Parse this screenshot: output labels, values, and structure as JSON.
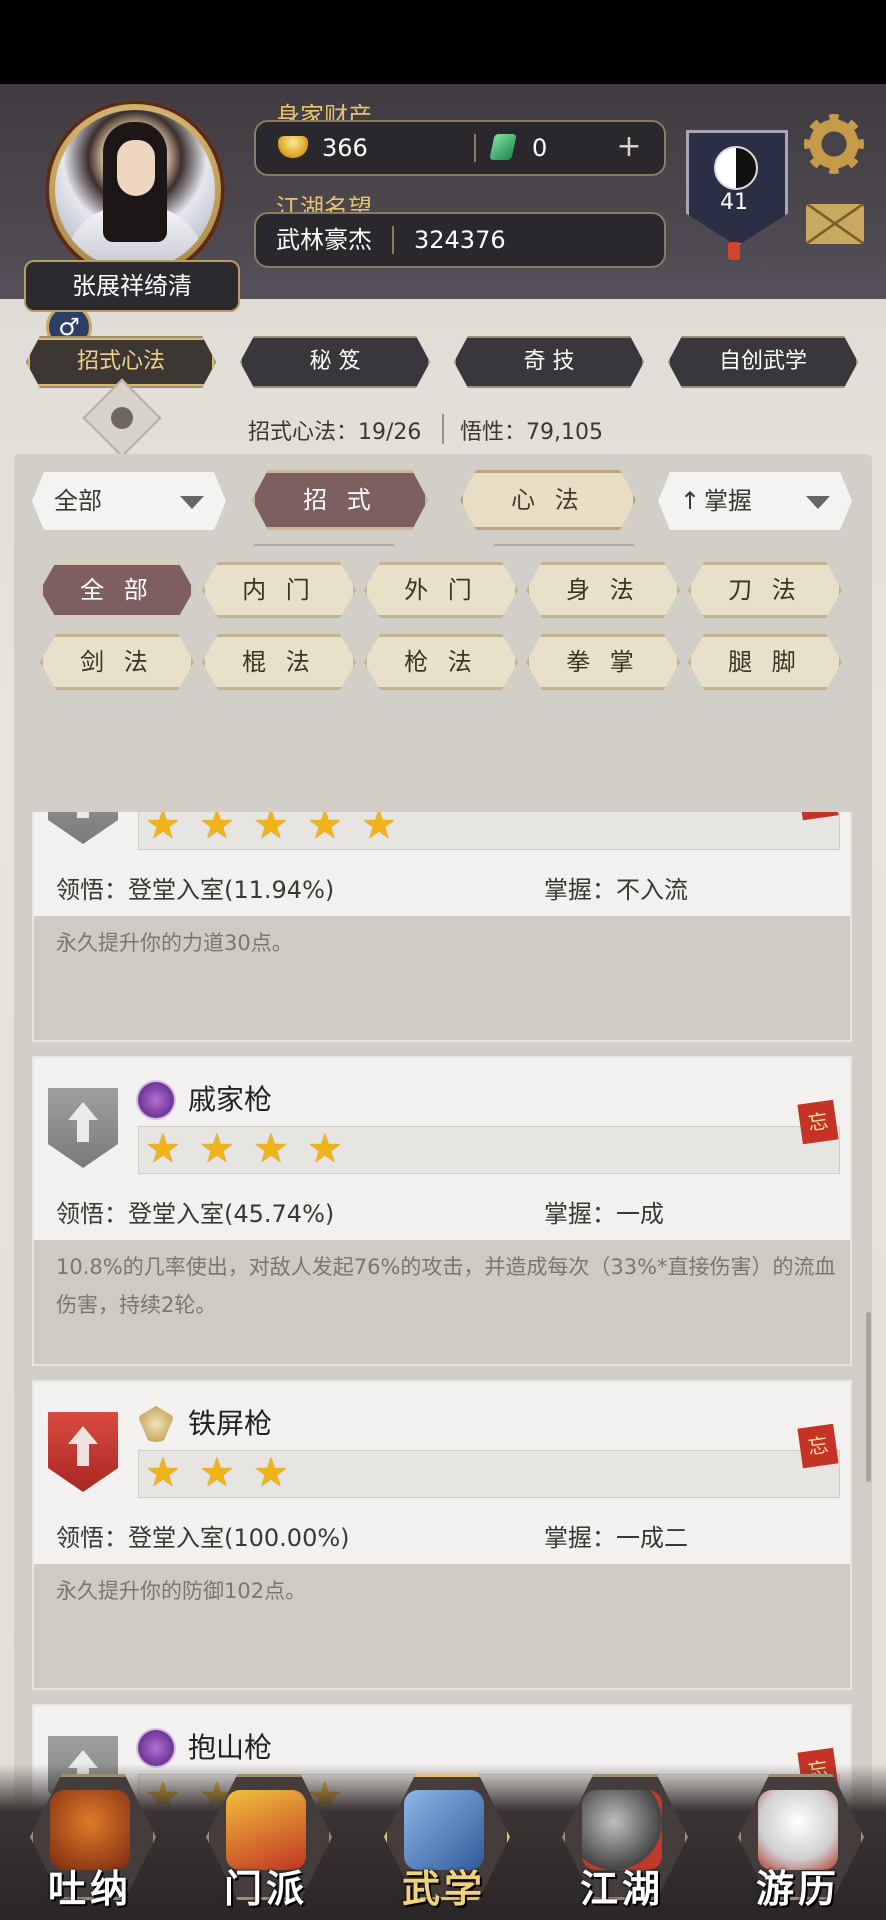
{
  "header": {
    "player_name": "张展祥绮清",
    "gender_symbol": "♂",
    "wealth_label": "身家财产",
    "gold": "366",
    "jade": "0",
    "plus": "+",
    "fame_label": "江湖名望",
    "fame_title": "武林豪杰",
    "fame_value": "324376",
    "level": "41"
  },
  "top_tabs": [
    "招式心法",
    "秘 笈",
    "奇 技",
    "自创武学"
  ],
  "stats": {
    "moves_label": "招式心法：19/26",
    "insight_label": "悟性：79,105"
  },
  "filters": {
    "category_dropdown": "全部",
    "type_buttons": [
      "招 式",
      "心 法"
    ],
    "sort_dropdown": "掌握",
    "sort_arrow": "↑",
    "chips_row1": [
      "全 部",
      "内 门",
      "外 门",
      "身 法",
      "刀 法"
    ],
    "chips_row2": [
      "剑 法",
      "棍 法",
      "枪 法",
      "拳 掌",
      "腿 脚"
    ]
  },
  "skills": [
    {
      "name": "",
      "stars": 5,
      "comprehension": "领悟：登堂入室(11.94%)",
      "mastery": "掌握：不入流",
      "description": "永久提升你的力道30点。",
      "forget_tag": "忘"
    },
    {
      "name": "戚家枪",
      "stars": 4,
      "comprehension": "领悟：登堂入室(45.74%)",
      "mastery": "掌握：一成",
      "description": "10.8%的几率使出，对敌人发起76%的攻击，并造成每次（33%*直接伤害）的流血伤害，持续2轮。",
      "forget_tag": "忘"
    },
    {
      "name": "铁屏枪",
      "stars": 3,
      "comprehension": "领悟：登堂入室(100.00%)",
      "mastery": "掌握：一成二",
      "description": "永久提升你的防御102点。",
      "forget_tag": "忘"
    },
    {
      "name": "抱山枪",
      "stars": 4,
      "forget_tag": "忘"
    }
  ],
  "nav": [
    "吐纳",
    "门派",
    "武学",
    "江湖",
    "游历"
  ],
  "colors": {
    "header_bg": "#4c474d",
    "accent_gold": "#e7c26e",
    "active_chip": "#7e5f60",
    "star": "#f1b418"
  }
}
